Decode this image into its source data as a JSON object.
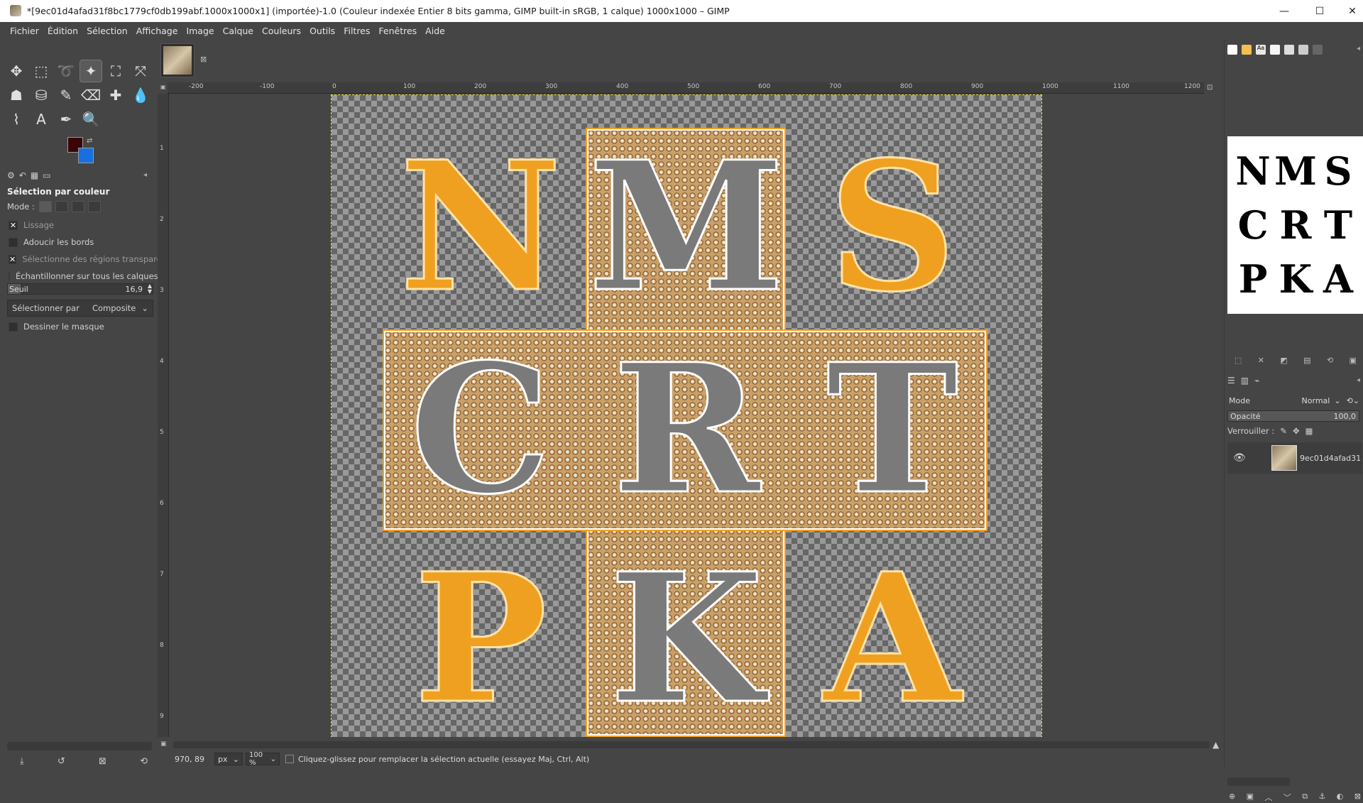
{
  "window": {
    "title": "*[9ec01d4afad31f8bc1779cf0db199abf.1000x1000x1] (importée)-1.0 (Couleur indexée Entier 8 bits gamma, GIMP built-in sRGB, 1 calque) 1000x1000 – GIMP",
    "minimize": "—",
    "maximize": "☐",
    "close": "✕"
  },
  "menu": [
    "Fichier",
    "Édition",
    "Sélection",
    "Affichage",
    "Image",
    "Calque",
    "Couleurs",
    "Outils",
    "Filtres",
    "Fenêtres",
    "Aide"
  ],
  "toolbox": {
    "tools": [
      {
        "name": "move-tool-icon",
        "glyph": "✥",
        "active": false
      },
      {
        "name": "rect-select-tool-icon",
        "glyph": "⬚",
        "active": false
      },
      {
        "name": "free-select-tool-icon",
        "glyph": "➰",
        "active": false
      },
      {
        "name": "fuzzy-select-tool-icon",
        "glyph": "✦",
        "active": true
      },
      {
        "name": "crop-tool-icon",
        "glyph": "⛶",
        "active": false
      },
      {
        "name": "transform-tool-icon",
        "glyph": "⤧",
        "active": false
      },
      {
        "name": "warp-tool-icon",
        "glyph": "☗",
        "active": false
      },
      {
        "name": "bucket-fill-tool-icon",
        "glyph": "⛁",
        "active": false
      },
      {
        "name": "paintbrush-tool-icon",
        "glyph": "✎",
        "active": false
      },
      {
        "name": "eraser-tool-icon",
        "glyph": "⌫",
        "active": false
      },
      {
        "name": "heal-tool-icon",
        "glyph": "✚",
        "active": false
      },
      {
        "name": "blur-tool-icon",
        "glyph": "💧",
        "active": false
      },
      {
        "name": "paths-tool-icon",
        "glyph": "⌇",
        "active": false
      },
      {
        "name": "text-tool-icon",
        "glyph": "A",
        "active": false
      },
      {
        "name": "color-picker-tool-icon",
        "glyph": "✒",
        "active": false
      },
      {
        "name": "zoom-tool-icon",
        "glyph": "🔍",
        "active": false
      }
    ],
    "fg_color": "#3a0505",
    "bg_color": "#1a6fe0"
  },
  "tool_options": {
    "title": "Sélection par couleur",
    "mode_label": "Mode :",
    "options": [
      {
        "label": "Lissage",
        "checked": true,
        "dim": true
      },
      {
        "label": "Adoucir les bords",
        "checked": false,
        "dim": false
      },
      {
        "label": "Sélectionne des régions transparentes",
        "checked": true,
        "dim": true
      },
      {
        "label": "Échantillonner sur tous les calques",
        "checked": false,
        "dim": false
      }
    ],
    "threshold_label": "Seuil",
    "threshold_value": "16,9",
    "select_by_label": "Sélectionner par",
    "select_by_value": "Composite",
    "draw_mask_label": "Dessiner le masque"
  },
  "ruler": {
    "top": [
      "-200",
      "-100",
      "0",
      "100",
      "200",
      "300",
      "400",
      "500",
      "600",
      "700",
      "800",
      "900",
      "1000",
      "1100",
      "1200"
    ],
    "left": [
      "1",
      "2",
      "3",
      "4",
      "5",
      "6",
      "7",
      "8",
      "9"
    ]
  },
  "artwork": {
    "letters": [
      "N",
      "M",
      "S",
      "C",
      "R",
      "T",
      "P",
      "K",
      "A"
    ]
  },
  "status": {
    "coords": "970, 89",
    "unit": "px",
    "zoom": "100 %",
    "message": "Cliquez-glissez pour remplacer la sélection actuelle (essayez Maj, Ctrl, Alt)"
  },
  "right_dock": {
    "preview_letters": [
      "N",
      "M",
      "S",
      "C",
      "R",
      "T",
      "P",
      "K",
      "A"
    ],
    "mode_label": "Mode",
    "mode_value": "Normal",
    "opacity_label": "Opacité",
    "opacity_value": "100,0",
    "lock_label": "Verrouiller :",
    "layer_name": "9ec01d4afad31"
  }
}
